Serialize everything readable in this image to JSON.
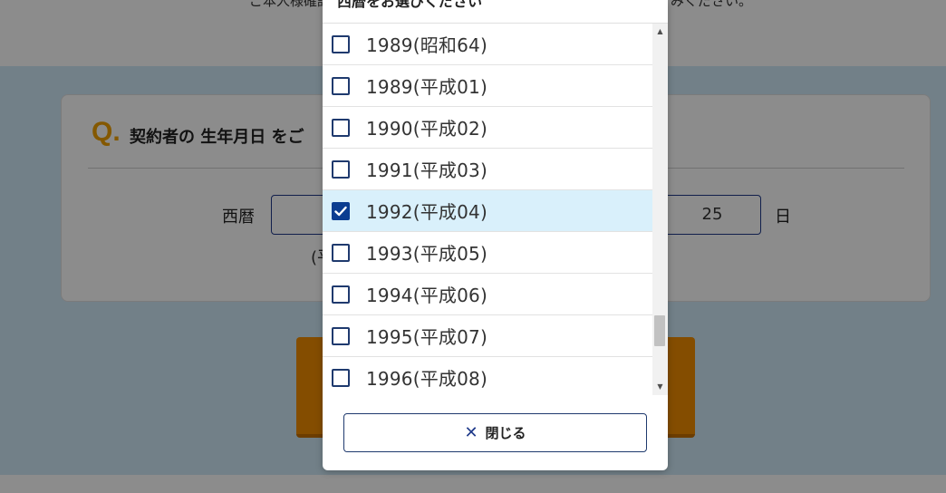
{
  "background": {
    "top_line_partial": "ご本人様確認",
    "top_line_partial_right": "みください。",
    "question": {
      "mark": "Q.",
      "text": "契約者の 生年月日 をご"
    },
    "era_label": "西暦",
    "day_value": "25",
    "day_unit": "日",
    "note_fragment": "(平"
  },
  "modal": {
    "title": "西暦をお選びください",
    "items": [
      {
        "label": "1989(昭和64)",
        "checked": false
      },
      {
        "label": "1989(平成01)",
        "checked": false
      },
      {
        "label": "1990(平成02)",
        "checked": false
      },
      {
        "label": "1991(平成03)",
        "checked": false
      },
      {
        "label": "1992(平成04)",
        "checked": true
      },
      {
        "label": "1993(平成05)",
        "checked": false
      },
      {
        "label": "1994(平成06)",
        "checked": false
      },
      {
        "label": "1995(平成07)",
        "checked": false
      },
      {
        "label": "1996(平成08)",
        "checked": false
      }
    ],
    "close_icon": "close-x-icon",
    "close_label": "閉じる"
  },
  "colors": {
    "accent_orange": "#f08c00",
    "checkbox_checked": "#0b3d91",
    "selected_row": "#d9f0fb",
    "question_mark": "#f0a000"
  }
}
